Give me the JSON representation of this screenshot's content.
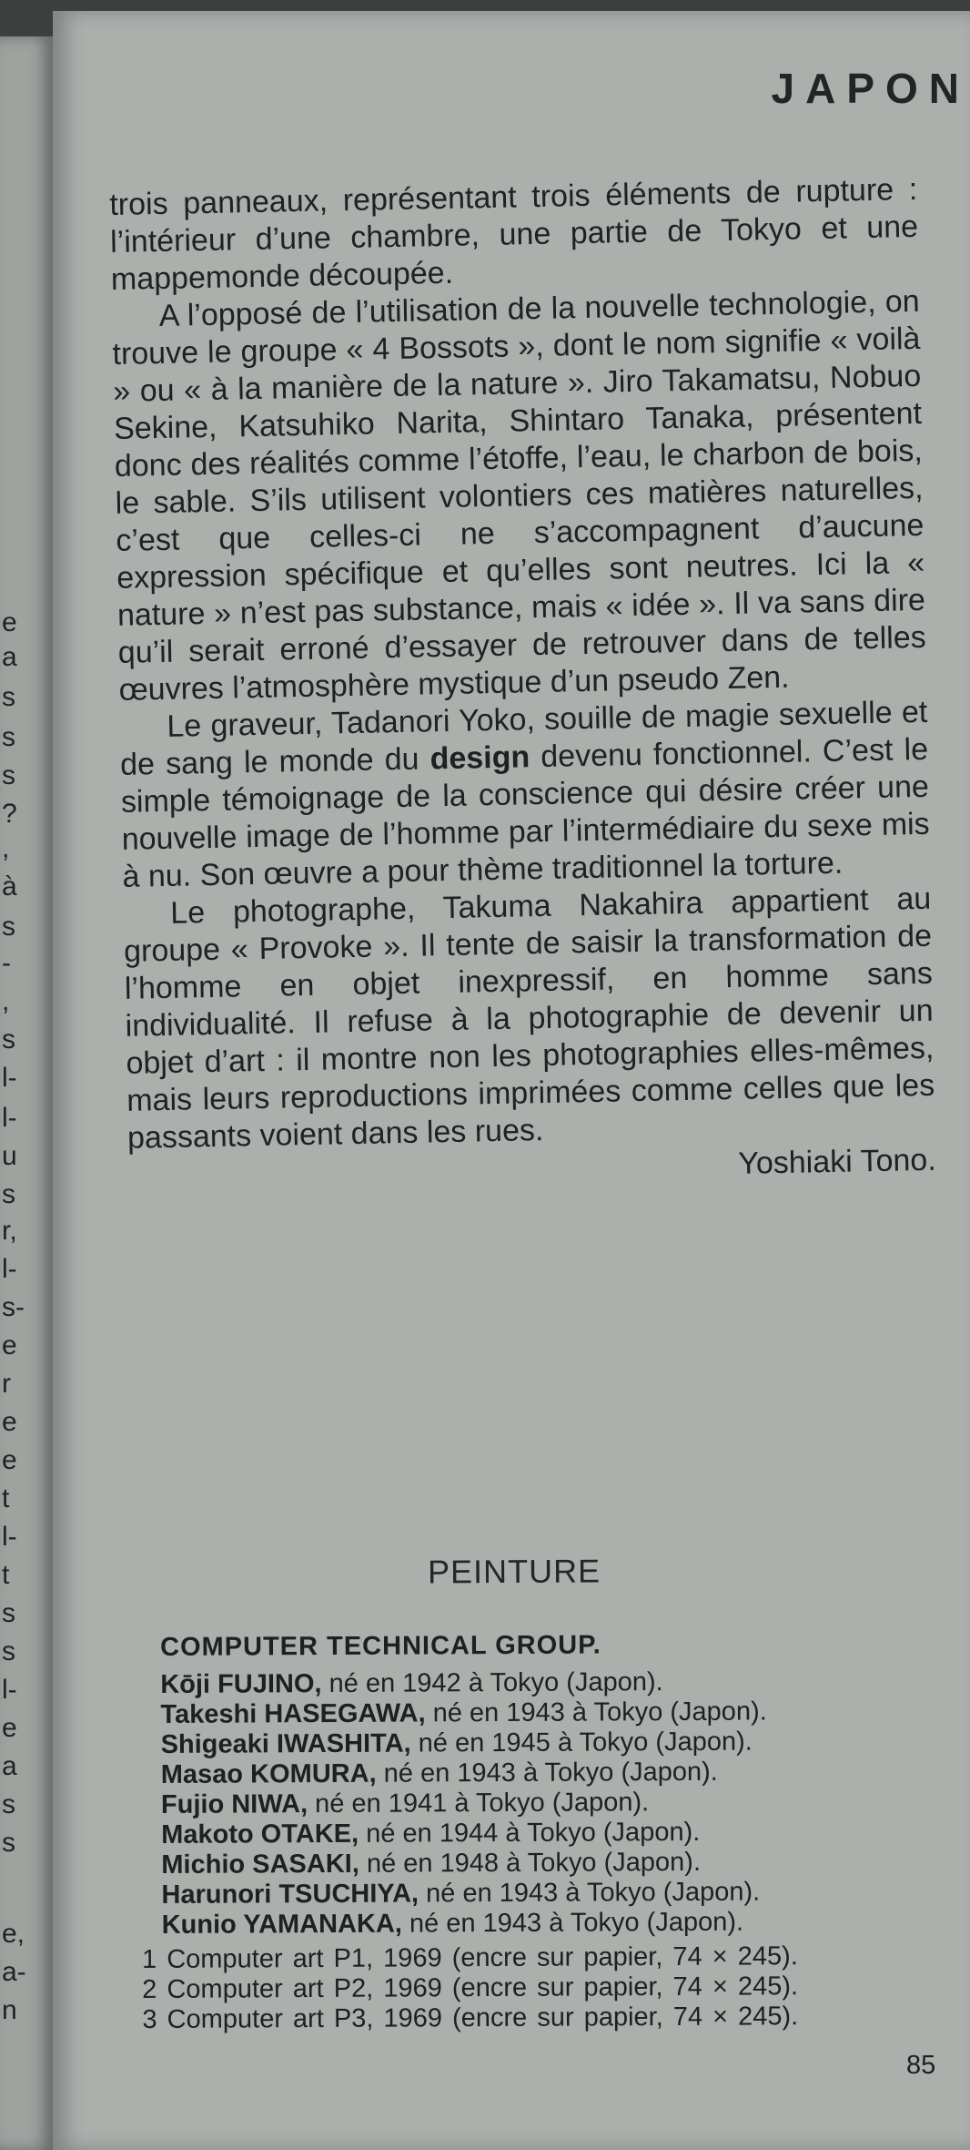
{
  "left_margin": {
    "chars": [
      "e",
      "a",
      "s",
      "s",
      "s",
      "?",
      ",",
      "à",
      "s",
      "-",
      ",",
      "s",
      "l-",
      "l-",
      "u",
      "s",
      "r,",
      "l-",
      "s-",
      "e",
      "r",
      "e",
      "e",
      "t",
      "l-",
      "t",
      "s",
      "s",
      "l-",
      "e",
      "a",
      "s",
      "s",
      "e,",
      "a-",
      "n"
    ]
  },
  "header": {
    "running_head": "JAPON"
  },
  "article": {
    "paragraphs": [
      "trois panneaux, représentant trois éléments de rupture : l’intérieur d’une chambre, une partie de Tokyo et une mappemonde découpée.",
      "A l’opposé de l’utilisation de la nouvelle technologie, on trouve le groupe « 4 Bossots », dont le nom signifie « voilà » ou « à la manière de la nature ». Jiro Takamatsu, Nobuo Sekine, Katsuhiko Narita, Shintaro Tanaka, présentent donc des réalités comme l’étoffe, l’eau, le charbon de bois, le sable. S’ils utilisent volontiers ces matières naturelles, c’est que celles-ci ne s’accompagnent d’aucune expression spécifique et qu’elles sont neutres. Ici la « nature » n’est pas substance, mais « idée ». Il va sans dire qu’il serait erroné d’essayer de retrouver dans de telles œuvres l’atmosphère mystique d’un pseudo Zen.",
      {
        "before": "Le graveur, Tadanori Yoko, souille de magie sexuelle et de sang le monde du ",
        "emphasis": "design",
        "after": " devenu fonctionnel. C’est le simple témoignage de la conscience qui désire créer une nouvelle image de l’homme par l’intermédiaire du sexe mis à nu. Son œuvre a pour thème traditionnel la torture."
      },
      "Le photographe, Takuma Nakahira appartient au groupe « Provoke ». Il tente de saisir la transformation de l’homme en objet inexpressif, en homme sans individualité. Il refuse à la photographie de devenir un objet d’art : il montre non les photographies elles-mêmes, mais leurs reproductions imprimées comme celles que les passants voient dans les rues."
    ],
    "signature": "Yoshiaki Tono."
  },
  "section": {
    "title": "PEINTURE"
  },
  "credits": {
    "group": "COMPUTER TECHNICAL GROUP.",
    "artists": [
      {
        "name": "Kōji FUJINO,",
        "details": " né en 1942 à Tokyo (Japon)."
      },
      {
        "name": "Takeshi HASEGAWA,",
        "details": " né en 1943 à Tokyo (Japon)."
      },
      {
        "name": "Shigeaki IWASHITA,",
        "details": " né en 1945 à Tokyo (Japon)."
      },
      {
        "name": "Masao KOMURA,",
        "details": " né en 1943 à Tokyo (Japon)."
      },
      {
        "name": "Fujio NIWA,",
        "details": " né en 1941 à Tokyo (Japon)."
      },
      {
        "name": "Makoto OTAKE,",
        "details": " né en 1944 à Tokyo (Japon)."
      },
      {
        "name": "Michio SASAKI,",
        "details": " né en 1948 à Tokyo (Japon)."
      },
      {
        "name": "Harunori TSUCHIYA,",
        "details": " né en 1943 à Tokyo (Japon)."
      },
      {
        "name": "Kunio YAMANAKA,",
        "details": " né en 1943 à Tokyo (Japon)."
      }
    ],
    "works": [
      "1 Computer art P1, 1969 (encre sur papier, 74 × 245).",
      "2 Computer art P2, 1969 (encre sur papier, 74 × 245).",
      "3 Computer art P3, 1969 (encre sur papier, 74 × 245)."
    ]
  },
  "footer": {
    "page_number": "85"
  }
}
